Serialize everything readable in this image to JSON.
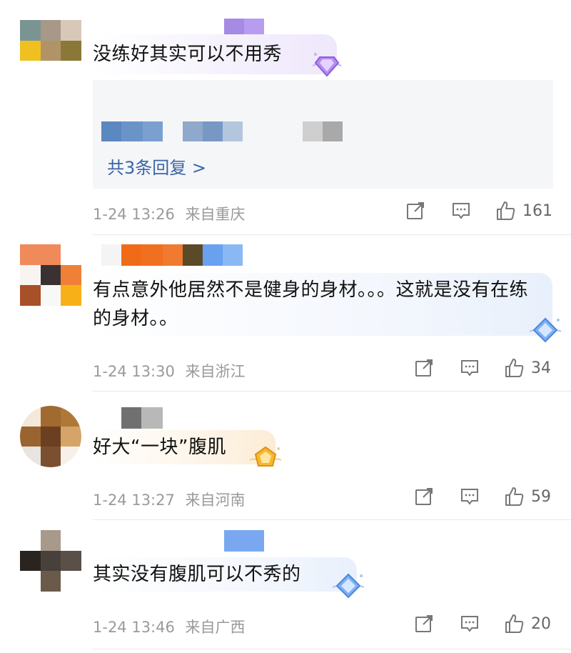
{
  "comments": [
    {
      "text": "没练好其实可以不用秀",
      "time": "1-24 13:26",
      "location": "来自重庆",
      "likes": "161",
      "replies_label": "共3条回复 >",
      "badge": "purple-diamond"
    },
    {
      "text": "有点意外他居然不是健身的身材。。。这就是没有在练的身材。。",
      "time": "1-24 13:30",
      "location": "来自浙江",
      "likes": "34",
      "badge": "blue-diamond"
    },
    {
      "text": "好大“一块”腹肌",
      "time": "1-24 13:27",
      "location": "来自河南",
      "likes": "59",
      "badge": "gold-diamond"
    },
    {
      "text": "其实没有腹肌可以不秀的",
      "time": "1-24 13:46",
      "location": "来自广西",
      "likes": "20",
      "badge": "blue-diamond"
    }
  ],
  "icons": {
    "share": "share-icon",
    "comment": "comment-icon",
    "like": "thumbs-up-icon"
  },
  "colors": {
    "link": "#3a64a8",
    "meta": "#9a9a9a",
    "reply_bg": "#f5f6f8"
  }
}
